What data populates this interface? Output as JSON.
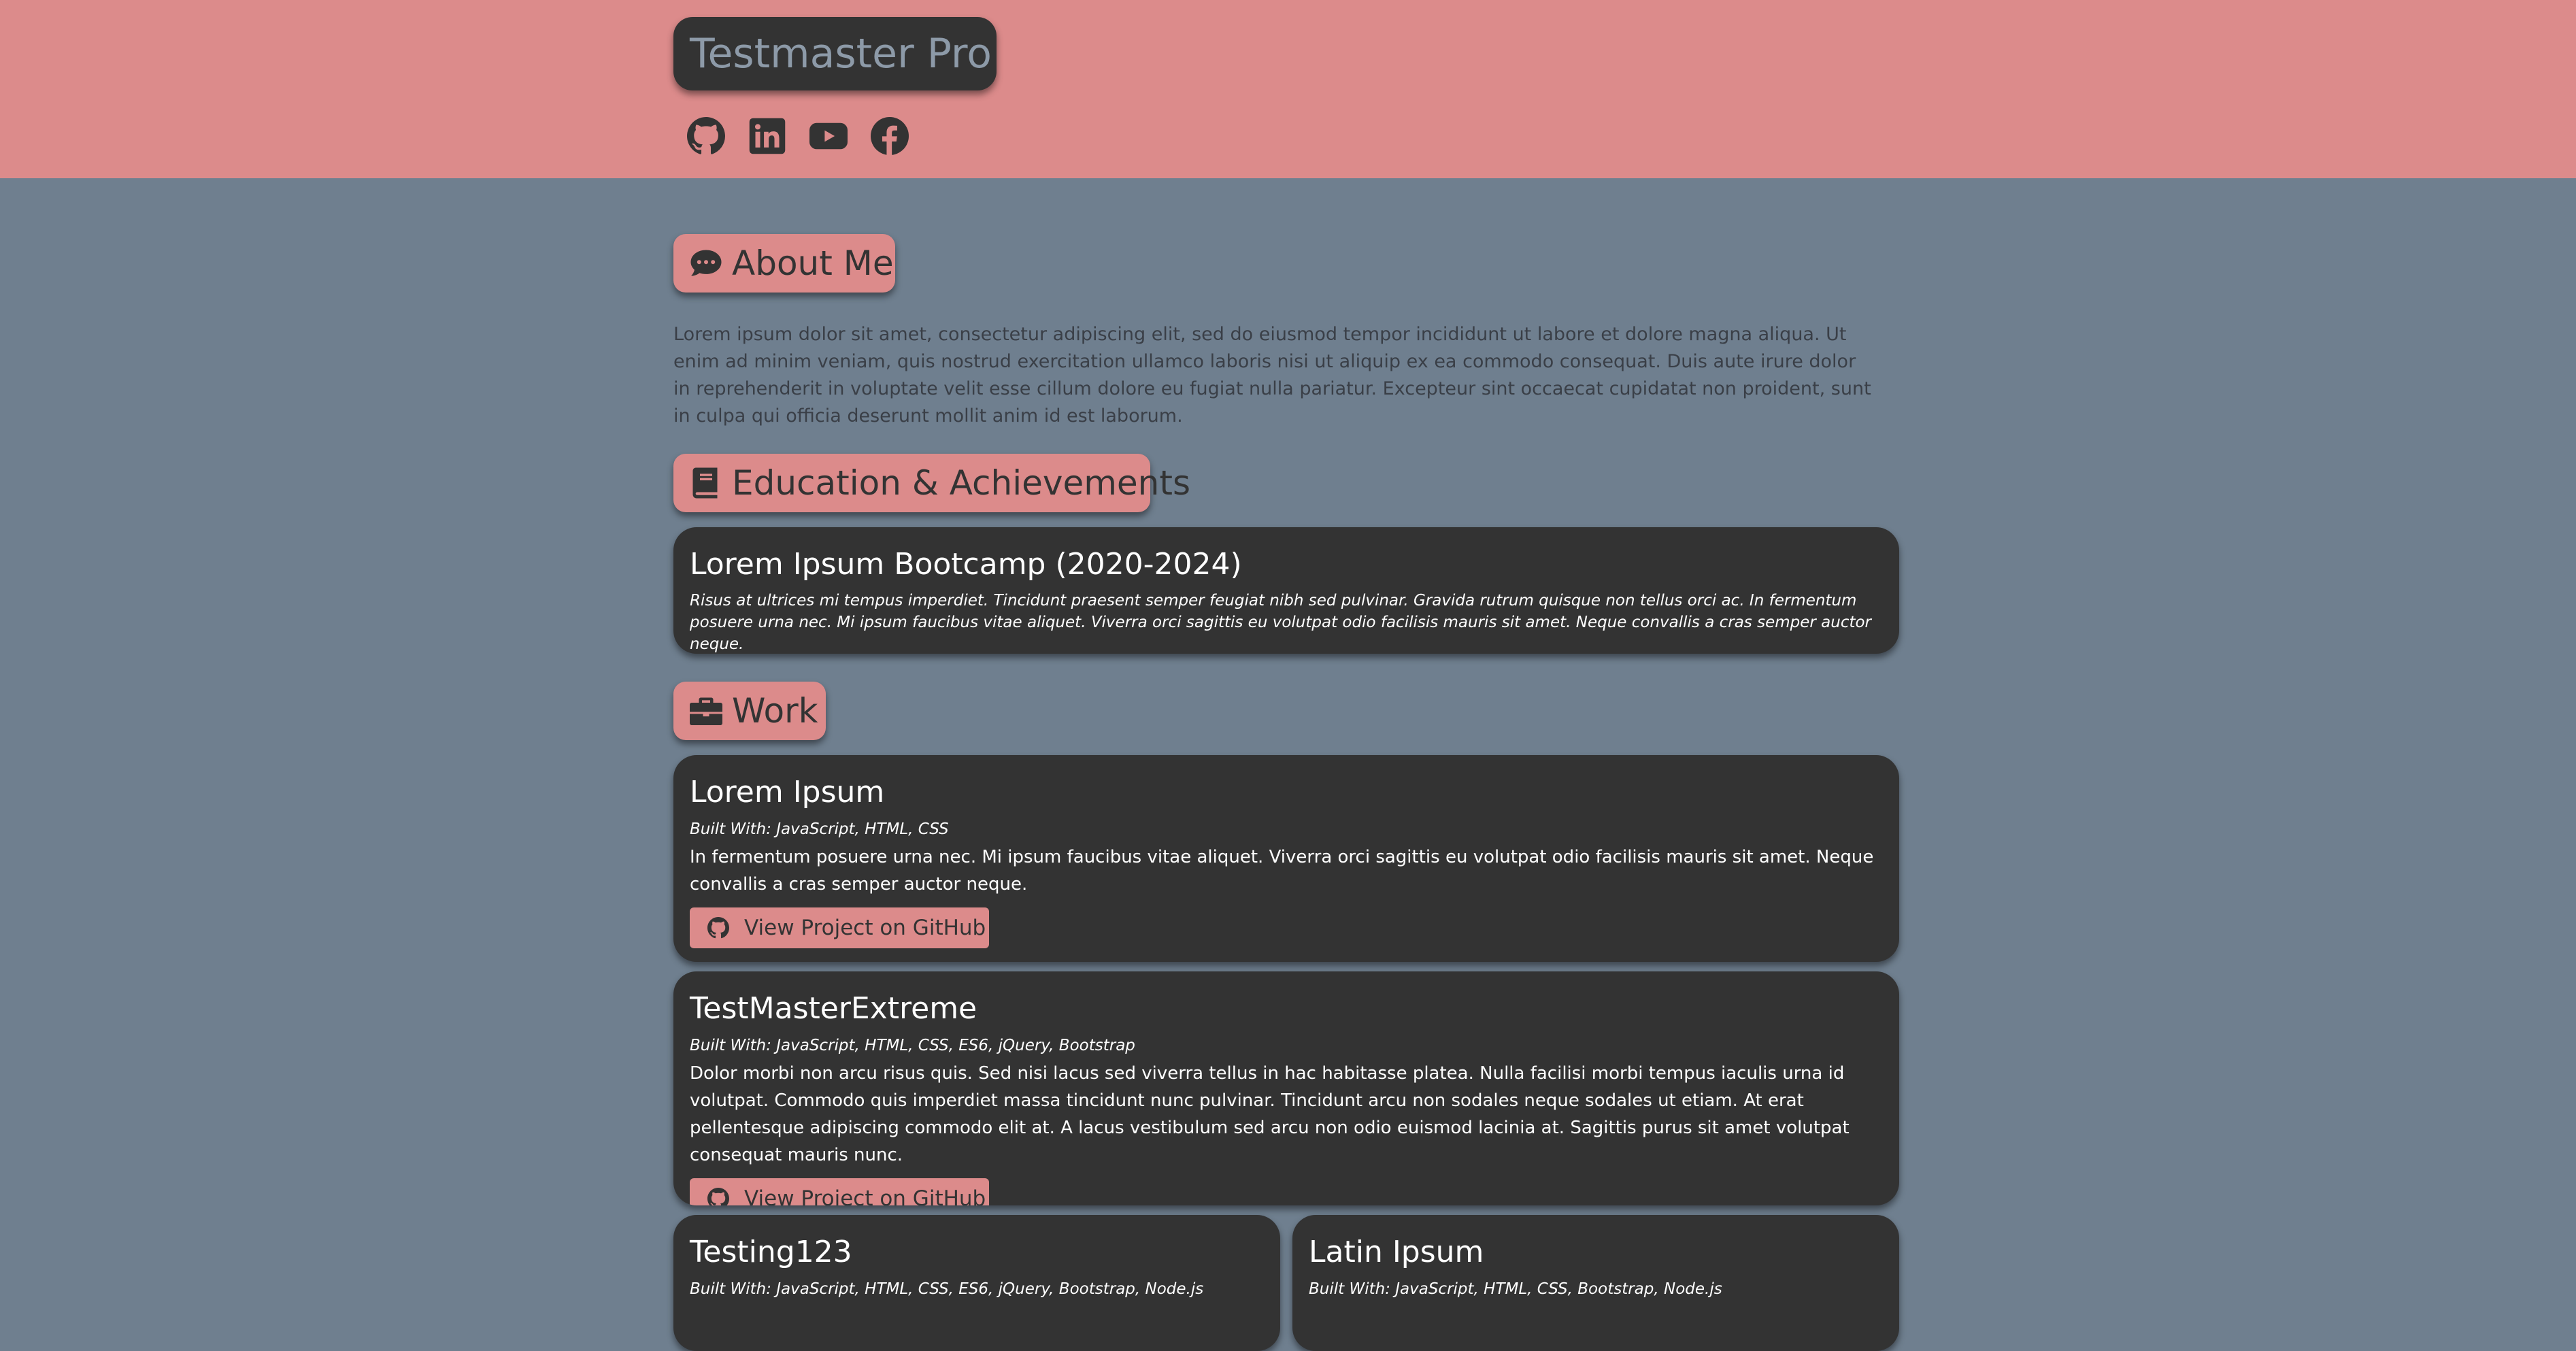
{
  "header": {
    "brand": "Testmaster Pro",
    "socials": [
      {
        "name": "github",
        "icon": "github-icon"
      },
      {
        "name": "linkedin",
        "icon": "linkedin-icon"
      },
      {
        "name": "youtube",
        "icon": "youtube-icon"
      },
      {
        "name": "facebook",
        "icon": "facebook-icon"
      }
    ]
  },
  "colors": {
    "accent": "#dc8b8b",
    "background": "#6f7f8f",
    "card": "#333333",
    "brand_text": "#8d9aa8"
  },
  "about": {
    "heading": "About Me",
    "icon": "comment-dots-icon",
    "text": "Lorem ipsum dolor sit amet, consectetur adipiscing elit, sed do eiusmod tempor incididunt ut labore et dolore magna aliqua. Ut enim ad minim veniam, quis nostrud exercitation ullamco laboris nisi ut aliquip ex ea commodo consequat. Duis aute irure dolor in reprehenderit in voluptate velit esse cillum dolore eu fugiat nulla pariatur. Excepteur sint occaecat cupidatat non proident, sunt in culpa qui officia deserunt mollit anim id est laborum."
  },
  "education": {
    "heading": "Education & Achievements",
    "icon": "book-icon",
    "items": [
      {
        "title": "Lorem Ipsum Bootcamp (2020-2024)",
        "desc": "Risus at ultrices mi tempus imperdiet. Tincidunt praesent semper feugiat nibh sed pulvinar. Gravida rutrum quisque non tellus orci ac. In fermentum posuere urna nec. Mi ipsum faucibus vitae aliquet. Viverra orci sagittis eu volutpat odio facilisis mauris sit amet. Neque convallis a cras semper auctor neque."
      }
    ]
  },
  "work": {
    "heading": "Work",
    "icon": "briefcase-icon",
    "button_label": "View Project on GitHub",
    "projects": [
      {
        "title": "Lorem Ipsum",
        "built": "Built With: JavaScript, HTML, CSS",
        "desc": "In fermentum posuere urna nec. Mi ipsum faucibus vitae aliquet. Viverra orci sagittis eu volutpat odio facilisis mauris sit amet. Neque convallis a cras semper auctor neque."
      },
      {
        "title": "TestMasterExtreme",
        "built": "Built With: JavaScript, HTML, CSS, ES6, jQuery, Bootstrap",
        "desc": "Dolor morbi non arcu risus quis. Sed nisi lacus sed viverra tellus in hac habitasse platea. Nulla facilisi morbi tempus iaculis urna id volutpat. Commodo quis imperdiet massa tincidunt nunc pulvinar. Tincidunt arcu non sodales neque sodales ut etiam. At erat pellentesque adipiscing commodo elit at. A lacus vestibulum sed arcu non odio euismod lacinia at. Sagittis purus sit amet volutpat consequat mauris nunc."
      },
      {
        "title": "Testing123",
        "built": "Built With: JavaScript, HTML, CSS, ES6, jQuery, Bootstrap, Node.js"
      },
      {
        "title": "Latin Ipsum",
        "built": "Built With: JavaScript, HTML, CSS, Bootstrap, Node.js"
      }
    ]
  }
}
